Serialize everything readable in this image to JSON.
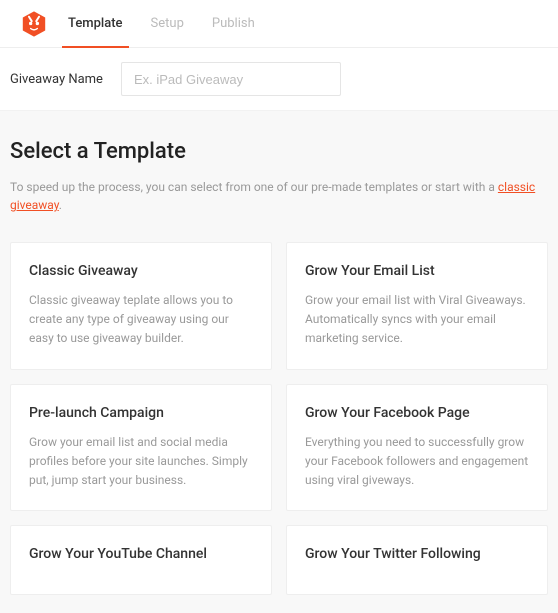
{
  "tabs": {
    "template": "Template",
    "setup": "Setup",
    "publish": "Publish"
  },
  "name_row": {
    "label": "Giveaway Name",
    "placeholder": "Ex. iPad Giveaway"
  },
  "section": {
    "title": "Select a Template",
    "desc_pre": "To speed up the process, you can select from one of our pre-made templates or start with a ",
    "link": "classic giveaway",
    "desc_post": "."
  },
  "cards": {
    "0": {
      "title": "Classic Giveaway",
      "desc": "Classic giveaway teplate allows you to create any type of giveaway using our easy to use giveaway builder."
    },
    "1": {
      "title": "Grow Your Email List",
      "desc": "Grow your email list with Viral Giveaways. Automatically syncs with your email marketing service."
    },
    "2": {
      "title": "Pre-launch Campaign",
      "desc": "Grow your email list and social media profiles before your site launches. Simply put, jump start your business."
    },
    "3": {
      "title": "Grow Your Facebook Page",
      "desc": "Everything you need to successfully grow your Facebook followers and engagement using viral giveways."
    },
    "4": {
      "title": "Grow Your YouTube Channel",
      "desc": ""
    },
    "5": {
      "title": "Grow Your Twitter Following",
      "desc": ""
    }
  }
}
